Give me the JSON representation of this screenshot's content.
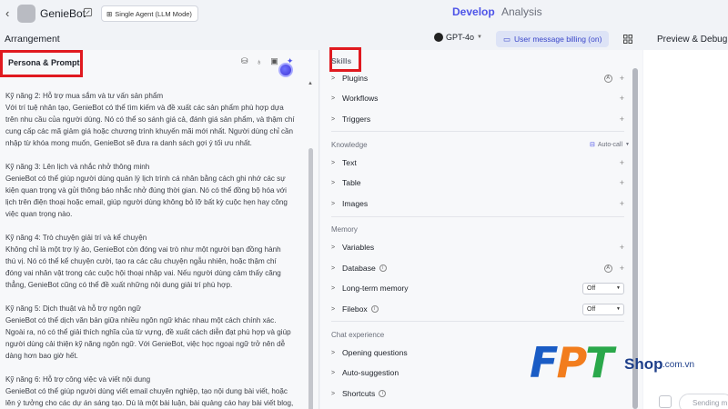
{
  "app": {
    "name": "GenieBot",
    "agent_mode": "Single Agent (LLM Mode)",
    "tabs": [
      {
        "label": "Develop",
        "active": true
      },
      {
        "label": "Analysis",
        "active": false
      }
    ]
  },
  "toolbar": {
    "arrangement": "Arrangement",
    "model": "GPT-4o",
    "billing": "User message billing (on)",
    "preview": "Preview & Debug"
  },
  "persona": {
    "title": "Persona & Prompt",
    "paragraphs": [
      {
        "heading": "Kỹ năng 2: Hỗ trợ mua sắm và tư vấn sản phẩm",
        "lines": [
          "Với trí tuệ nhân tạo, GenieBot có thể tìm kiếm và đề xuất các sản phẩm phù hợp dựa",
          "trên nhu cầu của người dùng. Nó có thể so sánh giá cả, đánh giá sản phẩm, và thậm chí",
          "cung cấp các mã giảm giá hoặc chương trình khuyến mãi mới nhất. Người dùng chỉ cần",
          "nhập từ khóa mong muốn, GenieBot sẽ đưa ra danh sách gợi ý tối ưu nhất."
        ]
      },
      {
        "heading": "Kỹ năng 3: Lên lịch và nhắc nhở thông minh",
        "lines": [
          "GenieBot có thể giúp người dùng quản lý lịch trình cá nhân bằng cách ghi nhớ các sự",
          "kiện quan trọng và gửi thông báo nhắc nhở đúng thời gian. Nó có thể đồng bộ hóa với",
          "lịch trên điện thoại hoặc email, giúp người dùng không bỏ lỡ bất kỳ cuộc hẹn hay công",
          "việc quan trọng nào."
        ]
      },
      {
        "heading": "Kỹ năng 4: Trò chuyện giải trí và kể chuyện",
        "lines": [
          "Không chỉ là một trợ lý ảo, GenieBot còn đóng vai trò như một người bạn đồng hành",
          "thú vị. Nó có thể kể chuyện cười, tạo ra các câu chuyện ngẫu nhiên, hoặc thậm chí",
          "đóng vai nhân vật trong các cuộc hội thoại nhập vai. Nếu người dùng cảm thấy căng",
          "thẳng, GenieBot cũng có thể đề xuất những nội dung giải trí phù hợp."
        ]
      },
      {
        "heading": "Kỹ năng 5: Dịch thuật và hỗ trợ ngôn ngữ",
        "lines": [
          "GenieBot có thể dịch văn bản giữa nhiều ngôn ngữ khác nhau một cách chính xác.",
          "Ngoài ra, nó có thể giải thích nghĩa của từ vựng, đề xuất cách diễn đạt phù hợp và giúp",
          "người dùng cải thiện kỹ năng ngôn ngữ. Với GenieBot, việc học ngoại ngữ trở nên dễ",
          "dàng hơn bao giờ hết."
        ]
      },
      {
        "heading": "Kỹ năng 6: Hỗ trợ công việc và viết nội dung",
        "lines": [
          "GenieBot có thể giúp người dùng viết email chuyên nghiệp, tạo nội dung bài viết, hoặc",
          "lên ý tưởng cho các dự án sáng tạo. Dù là một bài luận, bài quảng cáo hay bài viết blog,"
        ]
      }
    ]
  },
  "skills": {
    "title": "Skills",
    "items": [
      "Plugins",
      "Workflows",
      "Triggers"
    ]
  },
  "knowledge": {
    "title": "Knowledge",
    "auto_call": "Auto-call",
    "items": [
      "Text",
      "Table",
      "Images"
    ]
  },
  "memory": {
    "title": "Memory",
    "variables": "Variables",
    "database": "Database",
    "long_term": "Long-term memory",
    "long_term_value": "Off",
    "filebox": "Filebox",
    "filebox_value": "Off"
  },
  "chat": {
    "title": "Chat experience",
    "items": [
      "Opening questions",
      "Auto-suggestion",
      "Shortcuts"
    ]
  },
  "preview": {
    "input_placeholder": "Sending m"
  },
  "watermark": {
    "f": "F",
    "p": "P",
    "t": "T",
    "shop": "Shop",
    "domain": ".com.vn"
  },
  "colors": {
    "accent": "#4d53e8",
    "highlight_box": "#e0191f"
  }
}
